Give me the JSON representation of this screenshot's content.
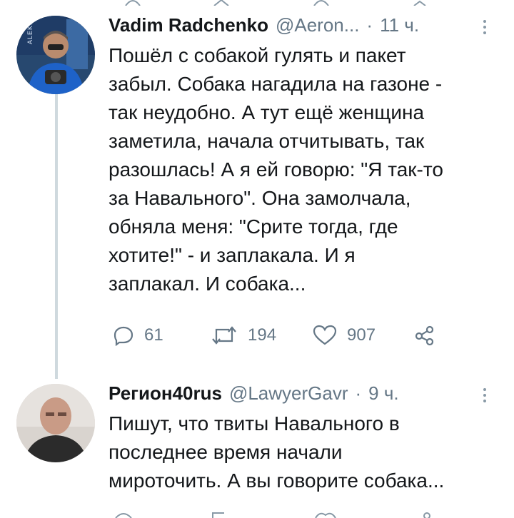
{
  "tweets": [
    {
      "display_name": "Vadim Radchenko",
      "handle": "@Aeron...",
      "separator": "·",
      "time": "11 ч.",
      "text": "Пошёл с собакой гулять и пакет\nзабыл. Собака нагадила на газоне -\nтак неудобно. А тут ещё женщина\nзаметила, начала отчитывать, так\nразошлась! А я ей говорю: \"Я так-то\nза Навального\". Она замолчала,\nобняла меня: \"Срите тогда, где\nхотите!\" - и заплакала. И я\nзаплакал. И собака...",
      "replies": "61",
      "retweets": "194",
      "likes": "907",
      "avatar_text": "ALEKSEY"
    },
    {
      "display_name": "Регион40rus",
      "handle": "@LawyerGavr",
      "separator": "·",
      "time": "9 ч.",
      "text": "Пишут, что твиты Навального в\nпоследнее время начали\nмироточить. А вы говорите собака..."
    }
  ],
  "colors": {
    "text": "#14171a",
    "meta": "#657786",
    "thread_line": "#cfd9de",
    "icon": "#657786"
  },
  "icons": [
    "reply-icon",
    "retweet-icon",
    "like-icon",
    "share-icon",
    "more-icon"
  ]
}
